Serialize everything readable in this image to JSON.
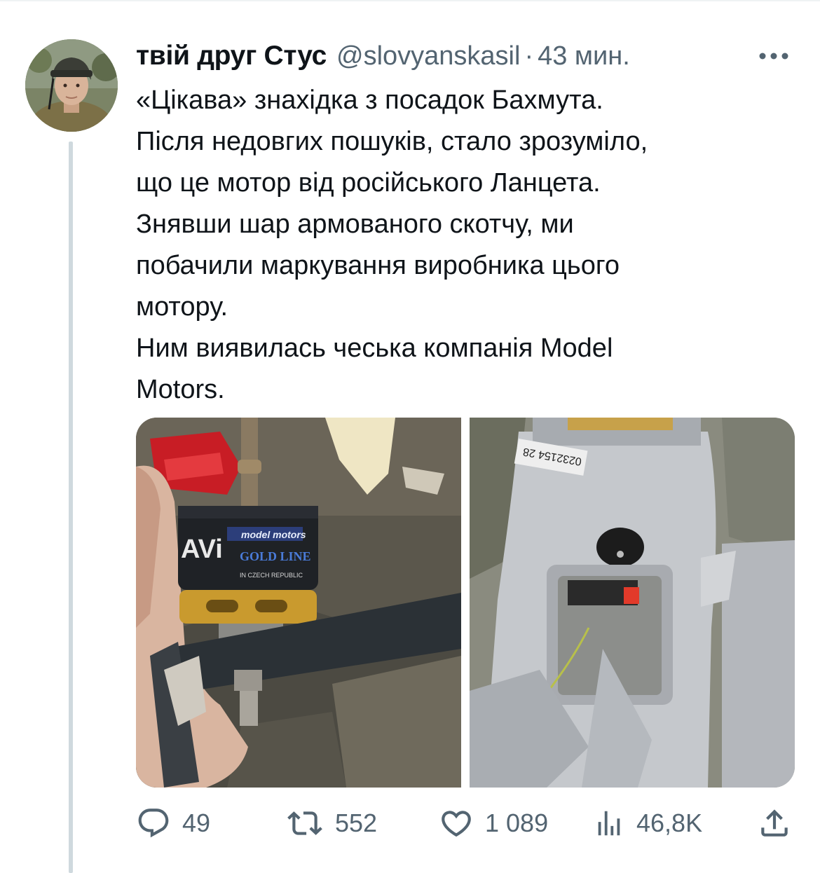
{
  "tweet": {
    "author": {
      "display_name": "твій друг Стус",
      "handle": "@slovyanskasil",
      "separator": "·",
      "time": "43 мин."
    },
    "text_lines": [
      "«Цікава» знахідка з посадок Бахмута.",
      "Після недовгих пошуків, стало зрозуміло,",
      "що це мотор від російського Ланцета.",
      "Знявши шар армованого скотчу, ми",
      "побачили маркування виробника цього",
      "мотору.",
      "Ним виявилась чеська компанія Model",
      "Motors."
    ],
    "media": {
      "left_photo": {
        "label_brand": "model motors",
        "label_line": "GOLD LINE",
        "label_origin": "IN CZECH REPUBLIC",
        "label_prefix": "AVi"
      },
      "right_photo": {
        "serial_text": "0232154 28"
      }
    },
    "actions": {
      "replies": {
        "icon": "reply-icon",
        "count": "49"
      },
      "retweets": {
        "icon": "retweet-icon",
        "count": "552"
      },
      "likes": {
        "icon": "heart-icon",
        "count": "1 089"
      },
      "views": {
        "icon": "views-icon",
        "count": "46,8K"
      },
      "share": {
        "icon": "share-icon"
      }
    },
    "colors": {
      "text_primary": "#0f1419",
      "text_secondary": "#536471",
      "thread_line": "#cfd9de"
    }
  }
}
